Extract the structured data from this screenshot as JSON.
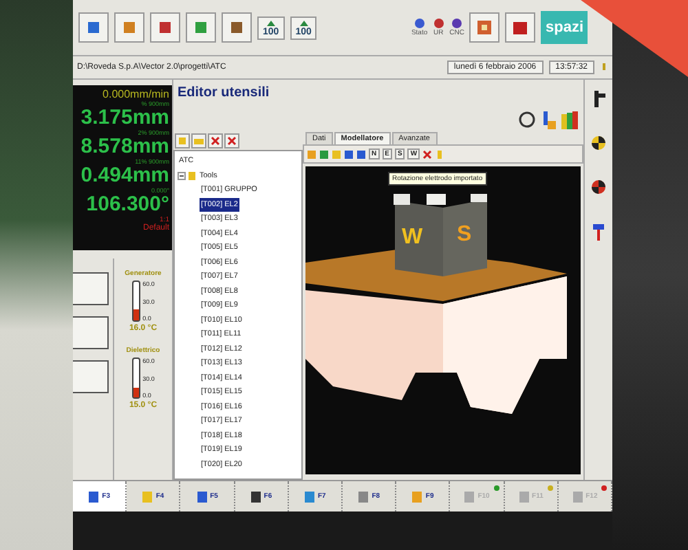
{
  "toolbar": {
    "percent_labels": [
      "100",
      "100"
    ],
    "status_labels": [
      "Stato",
      "UR",
      "CNC"
    ],
    "logo": "spazi"
  },
  "path_bar": {
    "path": "D:\\Roveda S.p.A\\Vector 2.0\\progetti\\ATC",
    "date": "lunedì 6 febbraio 2006",
    "time": "13:57:32"
  },
  "readout": {
    "feed": "0.000mm/min",
    "axes": [
      {
        "note": "% 900mm",
        "value": "3.175mm"
      },
      {
        "note": "2% 900mm",
        "value": "8.578mm"
      },
      {
        "note": "11% 900mm",
        "value": "0.494mm"
      },
      {
        "note": "0.000°",
        "value": "106.300°"
      }
    ],
    "scale": "1:1",
    "mode": "Default"
  },
  "temperatures": [
    {
      "title": "Generatore",
      "ticks": [
        "60.0",
        "30.0",
        "0.0"
      ],
      "level": 0.27,
      "reading": "16.0 °C"
    },
    {
      "title": "Dielettrico",
      "ticks": [
        "60.0",
        "30.0",
        "0.0"
      ],
      "level": 0.25,
      "reading": "15.0 °C"
    }
  ],
  "editor": {
    "title": "Editor utensili",
    "tree": [
      {
        "label": "ATC"
      },
      {
        "label": "Tools",
        "expanded": true,
        "children": [
          {
            "label": "[T001] GRUPPO",
            "selected": false
          },
          {
            "label": "[T002] EL2",
            "selected": true
          },
          {
            "label": "[T003] EL3",
            "selected": false
          },
          {
            "label": "[T004] EL4",
            "selected": false
          },
          {
            "label": "[T005] EL5",
            "selected": false
          },
          {
            "label": "[T006] EL6",
            "selected": false
          },
          {
            "label": "[T007] EL7",
            "selected": false
          },
          {
            "label": "[T008] EL8",
            "selected": false
          },
          {
            "label": "[T009] EL9",
            "selected": false
          },
          {
            "label": "[T010] EL10",
            "selected": false
          },
          {
            "label": "[T011] EL11",
            "selected": false
          },
          {
            "label": "[T012] EL12",
            "selected": false
          },
          {
            "label": "[T013] EL13",
            "selected": false
          },
          {
            "label": "[T014] EL14",
            "selected": false
          },
          {
            "label": "[T015] EL15",
            "selected": false
          },
          {
            "label": "[T016] EL16",
            "selected": false
          },
          {
            "label": "[T017] EL17",
            "selected": false
          },
          {
            "label": "[T018] EL18",
            "selected": false
          },
          {
            "label": "[T019] EL19",
            "selected": false
          },
          {
            "label": "[T020] EL20",
            "selected": false
          }
        ]
      }
    ],
    "tabs": [
      {
        "label": "Dati",
        "selected": false
      },
      {
        "label": "Modellatore",
        "selected": true
      },
      {
        "label": "Avanzate",
        "selected": false
      }
    ],
    "view_buttons": [
      "N",
      "E",
      "S",
      "W"
    ],
    "tooltip": "Rotazione elettrodo importato",
    "model_letters": [
      "W",
      "S"
    ]
  },
  "function_keys": [
    {
      "label": "F3",
      "selected": true,
      "disabled": false
    },
    {
      "label": "F4",
      "selected": false,
      "disabled": false
    },
    {
      "label": "F5",
      "selected": false,
      "disabled": false
    },
    {
      "label": "F6",
      "selected": false,
      "disabled": false
    },
    {
      "label": "F7",
      "selected": false,
      "disabled": false
    },
    {
      "label": "F8",
      "selected": false,
      "disabled": false
    },
    {
      "label": "F9",
      "selected": false,
      "disabled": false
    },
    {
      "label": "F10",
      "selected": false,
      "disabled": true,
      "color": "#2a9a2a"
    },
    {
      "label": "F11",
      "selected": false,
      "disabled": true,
      "color": "#c8b020"
    },
    {
      "label": "F12",
      "selected": false,
      "disabled": true,
      "color": "#d02020"
    }
  ]
}
